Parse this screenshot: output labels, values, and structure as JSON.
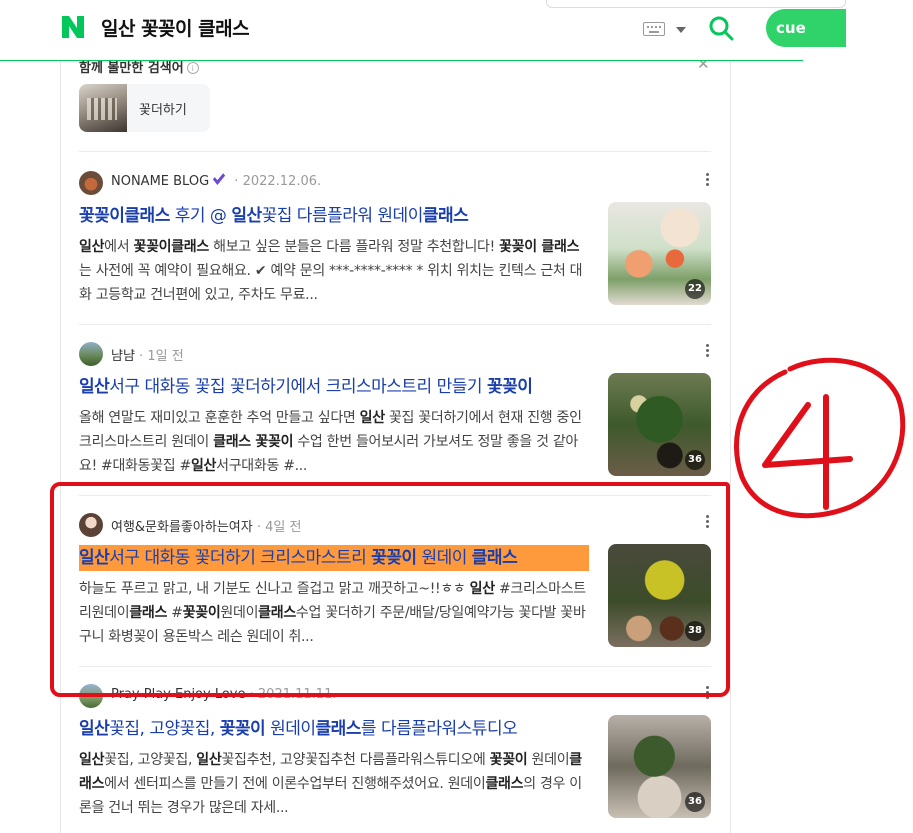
{
  "header": {
    "logo_letter": "N",
    "title": "일산 꽃꽂이 클래스",
    "green_button_text": "cue"
  },
  "related": {
    "title": "함께 볼만한 검색어",
    "chip_label": "꽃더하기"
  },
  "posts": [
    {
      "author": "NONAME BLOG",
      "date": "2022.12.06.",
      "title_html": "<b>꽃꽂이클래스</b><span class='n'> 후기 @ </span><b>일산</b><span class='n'>꽃집 다름플라워 원데이</span><b>클래스</b>",
      "desc_html": "<b>일산</b>에서 <b>꽃꽂이클래스</b> 해보고 싶은 분들은 다름 플라워 정말 추천합니다! <b>꽃꽂이 클래스</b>는 사전에 꼭 예약이 필요해요. ✔ 예약 문의 ***-****-**** * 위치 위치는 킨텍스 근처 대화 고등학교 건너편에 있고, 주차도 무료...",
      "count": "22"
    },
    {
      "author": "냠냠",
      "date": "1일 전",
      "title_html": "<b>일산</b><span class='n'>서구 대화동 꽃집 꽃더하기에서 크리스마스트리 만들기 </span><b>꽃꽂이</b>",
      "desc_html": "올해 연말도 재미있고 훈훈한 추억 만들고 싶다면 <b>일산</b> 꽃집 꽃더하기에서 현재 진행 중인 크리스마스트리 원데이 <b>클래스 꽃꽂이</b> 수업 한번 들어보시러 가보셔도 정말 좋을 것 같아요! #대화동꽃집 #<b>일산</b>서구대화동 #...",
      "count": "36"
    },
    {
      "author": "여행&문화를좋아하는여자",
      "date": "4일 전",
      "title_html": "<b>일산</b><span class='n'>서구 대화동 꽃더하기 크리스마스트리 </span><b>꽃꽂이</b><span class='n'> 원데이 </span><b>클래스</b>",
      "desc_html": "하늘도 푸르고 맑고, 내 기분도 신나고 즐겁고 맑고 깨끗하고~!!ㅎㅎ <b>일산</b> #크리스마스트리원데이<b>클래스</b> #<b>꽃꽂이</b>원데이<b>클래스</b>수업 꽃더하기 주문/배달/당일예약가능 꽃다발 꽃바구니 화병꽂이 용돈박스 레슨 원데이 취...",
      "count": "38"
    },
    {
      "author": "Pray Play Enjoy Love",
      "date": "2021.11.11.",
      "title_html": "<b>일산</b><span class='n'>꽃집, 고양꽃집, </span><b>꽃꽂이</b><span class='n'> 원데이</span><b>클래스</b><span class='n'>를 다름플라워스튜디오</span>",
      "desc_html": "<b>일산</b>꽃집, 고양꽃집, <b>일산</b>꽃집추천, 고양꽃집추천 다름플라워스튜디오에 <b>꽃꽂이</b> 원데이<b>클래스</b>에서 센터피스를 만들기 전에 이론수업부터 진행해주셨어요. 원데이<b>클래스</b>의 경우 이론을 건너 뛰는 경우가 많은데 자세...",
      "count": "36"
    }
  ],
  "annotation": {
    "number": "4",
    "color": "#e0101a"
  }
}
